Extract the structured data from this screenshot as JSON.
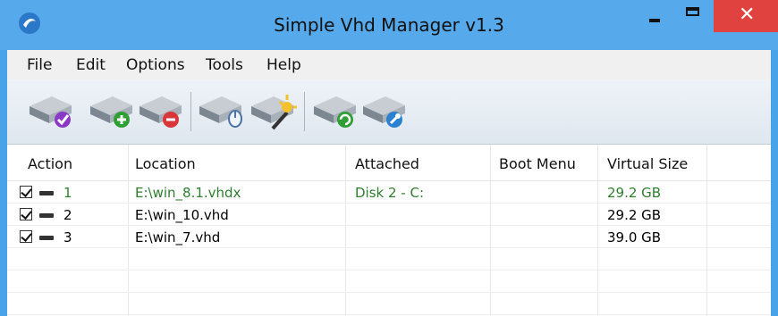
{
  "window": {
    "title": "Simple Vhd Manager v1.3",
    "minimize_icon": "minimize-icon",
    "maximize_icon": "maximize-icon",
    "close_label": "✕"
  },
  "menu": [
    "File",
    "Edit",
    "Options",
    "Tools",
    "Help"
  ],
  "toolbar": {
    "buttons": [
      "drive-check-icon",
      "drive-add-icon",
      "drive-remove-icon",
      "drive-mouse-icon",
      "drive-wand-icon",
      "drive-refresh-icon",
      "drive-settings-icon"
    ]
  },
  "table": {
    "columns": [
      "Action",
      "Location",
      "Attached",
      "Boot Menu",
      "Virtual Size"
    ],
    "rows": [
      {
        "checked": true,
        "id": "1",
        "location": "E:\\win_8.1.vhdx",
        "attached": "Disk 2  -  C:",
        "boot_menu": "",
        "size": "29.2 GB",
        "highlight": true
      },
      {
        "checked": true,
        "id": "2",
        "location": "E:\\win_10.vhd",
        "attached": "",
        "boot_menu": "",
        "size": "29.2 GB",
        "highlight": false
      },
      {
        "checked": true,
        "id": "3",
        "location": "E:\\win_7.vhd",
        "attached": "",
        "boot_menu": "",
        "size": "39.0 GB",
        "highlight": false
      }
    ]
  },
  "colors": {
    "titlebar": "#56a9ea",
    "close": "#e0433f",
    "highlight_text": "#2f7d2f"
  }
}
